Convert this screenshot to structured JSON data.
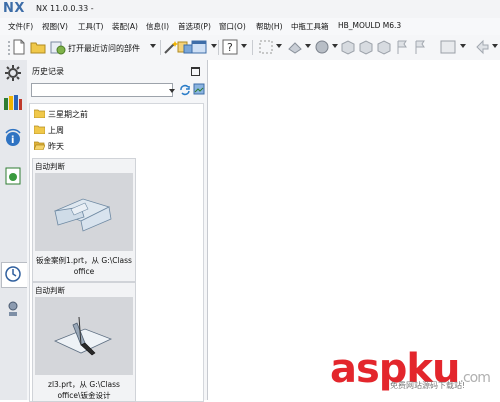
{
  "window": {
    "logo": "NX",
    "title": "NX 11.0.0.33 -"
  },
  "menu": [
    "文件(F)",
    "视图(V)",
    "工具(T)",
    "装配(A)",
    "信息(I)",
    "首选项(P)",
    "窗口(O)",
    "帮助(H)",
    "中瓶工具箱",
    "HB_MOULD M6.3"
  ],
  "toolbar": {
    "open_recent_label": "打开最近访问的部件"
  },
  "history": {
    "title": "历史记录",
    "search_value": "",
    "folders": [
      "三星期之前",
      "上周",
      "昨天"
    ],
    "cards": [
      {
        "header": "自动判断",
        "caption_line1": "钣金案例1.prt，从 G:\\Class",
        "caption_line2": "office"
      },
      {
        "header": "自动判断",
        "caption_line1": "zl3.prt，从 G:\\Class",
        "caption_line2": "office\\钣金设计"
      }
    ]
  },
  "watermark": {
    "brand": "aspku",
    "suffix": ".com",
    "tagline": "免费网站源码下载站!"
  },
  "colors": {
    "accent": "#3d6da8",
    "watermark_red": "#e3262c"
  }
}
